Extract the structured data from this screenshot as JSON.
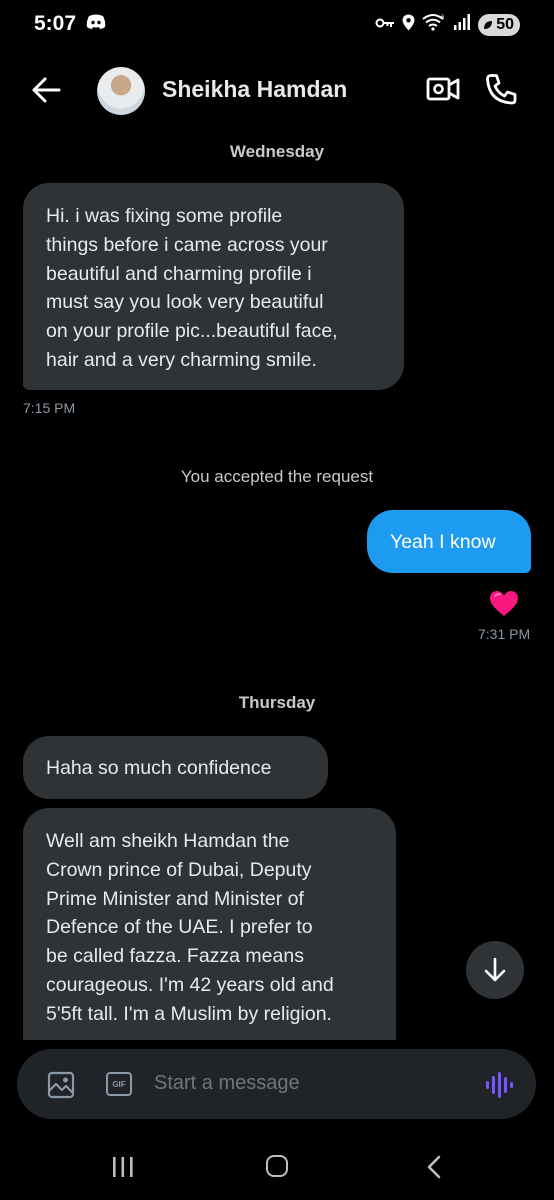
{
  "status_bar": {
    "time": "5:07",
    "battery": "50"
  },
  "header": {
    "contact_name": "Sheikha Hamdan"
  },
  "messages": {
    "day1": "Wednesday",
    "msg1": [
      "Hi. i was fixing some profile",
      "things before i came across your",
      "beautiful and charming profile i",
      "must say you look very beautiful",
      "on your profile pic...beautiful face,",
      "hair and a very charming smile."
    ],
    "msg1_time": "7:15 PM",
    "system": "You accepted the request",
    "msg2": "Yeah I know",
    "msg2_reaction": "heart",
    "msg2_time": "7:31 PM",
    "day2": "Thursday",
    "msg3": "Haha so much confidence",
    "msg4": [
      "Well am sheikh Hamdan the",
      "Crown prince of Dubai, Deputy",
      "Prime Minister and Minister of",
      "Defence of the UAE.  I prefer to",
      "be called fazza. Fazza means",
      "courageous. I'm 42 years old and",
      "5'5ft tall. I'm a Muslim by religion."
    ]
  },
  "composer": {
    "placeholder": "Start a message",
    "gif_label": "GIF"
  },
  "colors": {
    "background": "#000000",
    "incoming_bubble": "#2f3336",
    "outgoing_bubble": "#1d9bf0",
    "voice_accent": "#7856ff",
    "reaction": "#f91880"
  }
}
